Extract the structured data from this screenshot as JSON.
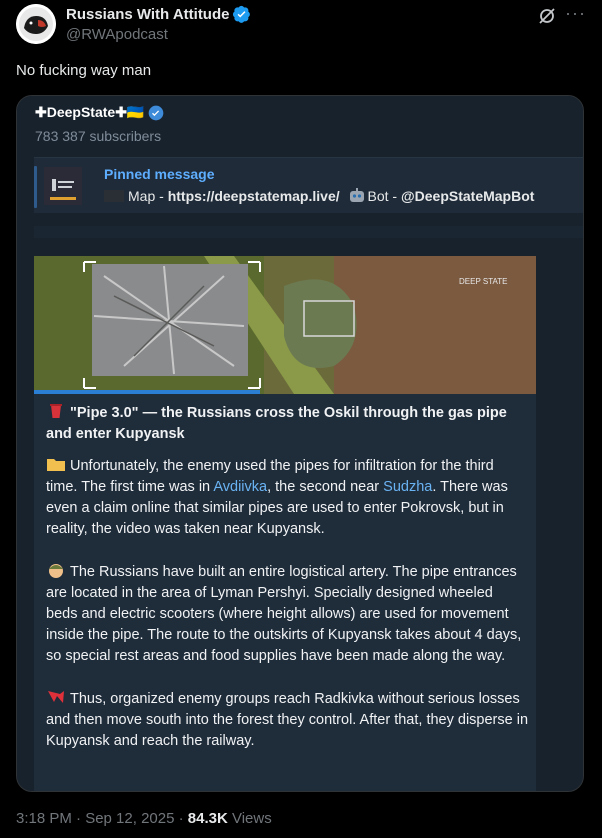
{
  "tweet": {
    "display_name": "Russians With Attitude",
    "handle": "@RWApodcast",
    "text": "No fucking way man",
    "timestamp": "3:18 PM · Sep 12, 2025",
    "views_count": "84.3K",
    "views_label": "Views"
  },
  "telegram": {
    "channel_name": "✚DeepState✚🇺🇦",
    "subscribers": "783 387 subscribers",
    "pinned_title": "Pinned message",
    "pinned_map": "Map - ",
    "pinned_map_url": "https://deepstatemap.live/",
    "pinned_bot": "Bot - ",
    "pinned_bot_handle": "@DeepStateMapBot",
    "image_watermark": "DEEP STATE",
    "headline": "\"Pipe 3.0\" — the Russians cross the Oskil through the gas pipe and enter Kupyansk",
    "p1_a": "Unfortunately, the enemy used the pipes for infiltration for the third time. The first time was in ",
    "p1_link1": "Avdiivka",
    "p1_b": ", the second near ",
    "p1_link2": "Sudzha",
    "p1_c": ". There was even a claim online that similar pipes are used to enter Pokrovsk, but in reality, the video was taken near Kupyansk.",
    "p2": "The Russians have built an entire logistical artery. The pipe entrances are located in the area of Lyman Pershyi. Specially designed wheeled beds and electric scooters (where height allows) are used for movement inside the pipe. The route to the outskirts of Kupyansk takes about 4 days, so special rest areas and food supplies have been made along the way.",
    "p3": "Thus, organized enemy groups reach Radkivka without serious losses and then move south into the forest they control. After that, they disperse in Kupyansk and reach the railway."
  },
  "colors": {
    "background": "#000000",
    "link": "#6ab3f3",
    "pinned_title": "#5eaeff",
    "verified": "#1d9bf0"
  }
}
